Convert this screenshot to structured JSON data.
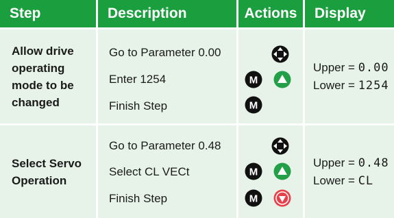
{
  "colors": {
    "header_bg": "#1b9e3e",
    "row_bg": "#e7f3e8",
    "up_button": "#23a047",
    "stop_button": "#e8404b"
  },
  "headers": {
    "step": "Step",
    "description": "Description",
    "actions": "Actions",
    "display": "Display"
  },
  "rows": [
    {
      "step": "Allow drive operating mode to be changed",
      "descriptions": [
        "Go to Parameter 0.00",
        "Enter 1254",
        "Finish Step"
      ],
      "actions": [
        "navigation-pad-icon",
        "mode-button-icon",
        "up-arrow-button-icon",
        "mode-button-icon"
      ],
      "display": {
        "upper_label": "Upper = ",
        "upper_value": "0.00",
        "lower_label": "Lower = ",
        "lower_value": "1254"
      }
    },
    {
      "step": "Select Servo Operation",
      "descriptions": [
        "Go to Parameter 0.48",
        "Select CL VECt",
        "Finish Step"
      ],
      "actions": [
        "navigation-pad-icon",
        "mode-button-icon",
        "up-arrow-button-icon",
        "mode-button-icon",
        "stop-reset-button-icon"
      ],
      "display": {
        "upper_label": "Upper = ",
        "upper_value": "0.48",
        "lower_label": "Lower = ",
        "lower_value": "CL"
      }
    }
  ],
  "icon_letter": "M"
}
